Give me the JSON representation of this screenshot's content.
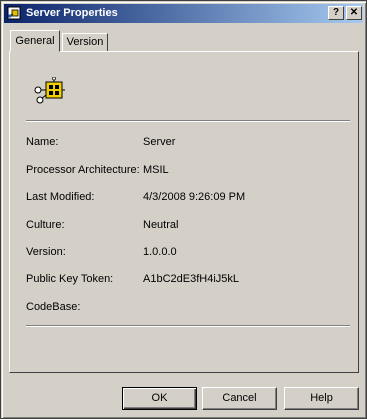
{
  "window": {
    "title": "Server Properties"
  },
  "tabs": [
    {
      "label": "General"
    },
    {
      "label": "Version"
    }
  ],
  "properties": [
    {
      "label": "Name:",
      "value": "Server"
    },
    {
      "label": "Processor Architecture:",
      "value": "MSIL"
    },
    {
      "label": "Last Modified:",
      "value": "4/3/2008 9:26:09 PM"
    },
    {
      "label": "Culture:",
      "value": "Neutral"
    },
    {
      "label": "Version:",
      "value": "1.0.0.0"
    },
    {
      "label": "Public Key Token:",
      "value": "A1bC2dE3fH4iJ5kL"
    },
    {
      "label": "CodeBase:",
      "value": ""
    }
  ],
  "buttons": {
    "ok": "OK",
    "cancel": "Cancel",
    "help": "Help"
  },
  "titlebar_buttons": {
    "help": "?",
    "close": "✕"
  },
  "colors": {
    "face": "#d4d0c8",
    "titlebar_start": "#0a246a",
    "titlebar_end": "#a6caf0"
  },
  "icons": {
    "title": "assembly-icon",
    "panel": "assembly-icon"
  }
}
